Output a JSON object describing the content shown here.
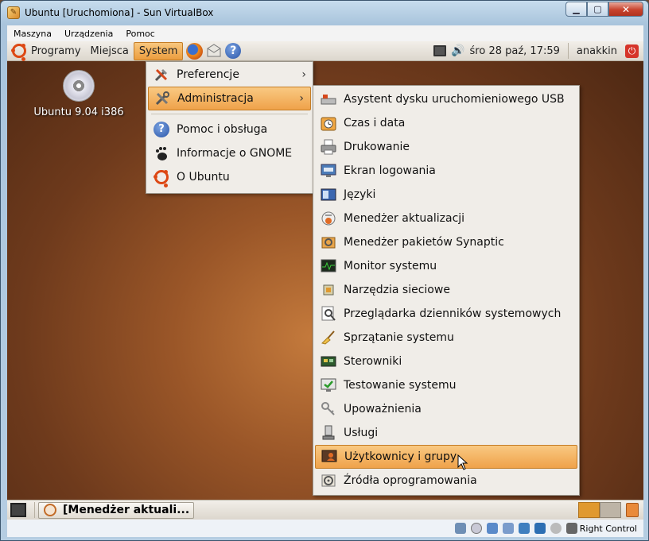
{
  "window": {
    "title": "Ubuntu [Uruchomiona] - Sun VirtualBox",
    "minimize": "▁",
    "maximize": "▢",
    "close": "✕"
  },
  "vbox_menu": [
    "Maszyna",
    "Urządzenia",
    "Pomoc"
  ],
  "top_panel": {
    "programy": "Programy",
    "miejsca": "Miejsca",
    "system": "System",
    "clock": "śro 28 paź, 17:59",
    "user": "anakkin",
    "help": "?"
  },
  "desktop_icon": {
    "label": "Ubuntu 9.04 i386",
    "icon": "cd-icon"
  },
  "system_menu": [
    {
      "label": "Preferencje",
      "icon": "preferences-icon",
      "submenu": true
    },
    {
      "label": "Administracja",
      "icon": "administration-icon",
      "submenu": true,
      "highlighted": true
    },
    {
      "label": "Pomoc i obsługa",
      "icon": "help-icon"
    },
    {
      "label": "Informacje o GNOME",
      "icon": "gnome-foot-icon"
    },
    {
      "label": "O Ubuntu",
      "icon": "ubuntu-icon"
    }
  ],
  "admin_menu": [
    {
      "label": "Asystent dysku uruchomieniowego USB",
      "icon": "usb-disk-icon"
    },
    {
      "label": "Czas i data",
      "icon": "clock-icon"
    },
    {
      "label": "Drukowanie",
      "icon": "printer-icon"
    },
    {
      "label": "Ekran logowania",
      "icon": "login-screen-icon"
    },
    {
      "label": "Języki",
      "icon": "language-icon"
    },
    {
      "label": "Menedżer aktualizacji",
      "icon": "update-manager-icon"
    },
    {
      "label": "Menedżer pakietów Synaptic",
      "icon": "synaptic-icon"
    },
    {
      "label": "Monitor systemu",
      "icon": "system-monitor-icon"
    },
    {
      "label": "Narzędzia sieciowe",
      "icon": "network-tools-icon"
    },
    {
      "label": "Przeglądarka dzienników systemowych",
      "icon": "log-viewer-icon"
    },
    {
      "label": "Sprzątanie systemu",
      "icon": "broom-icon"
    },
    {
      "label": "Sterowniki",
      "icon": "drivers-icon"
    },
    {
      "label": "Testowanie systemu",
      "icon": "system-testing-icon"
    },
    {
      "label": "Upoważnienia",
      "icon": "keys-icon"
    },
    {
      "label": "Usługi",
      "icon": "services-icon"
    },
    {
      "label": "Użytkownicy i grupy",
      "icon": "users-groups-icon",
      "highlighted": true
    },
    {
      "label": "Źródła oprogramowania",
      "icon": "software-sources-icon"
    }
  ],
  "bottom_panel": {
    "task": "[Menedżer aktuali..."
  },
  "vbox_status": {
    "host_key": "Right Control"
  },
  "colors": {
    "highlight": "#efa24a",
    "ubuntu_orange": "#dd4814",
    "panel": "#dcd7cd"
  }
}
